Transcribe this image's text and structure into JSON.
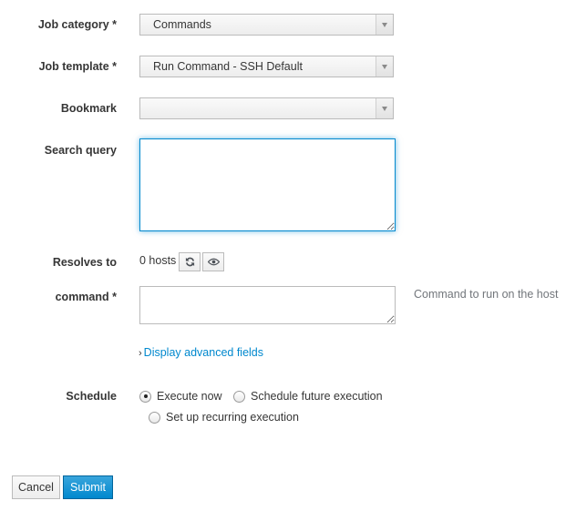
{
  "form": {
    "job_category": {
      "label": "Job category *",
      "value": "Commands"
    },
    "job_template": {
      "label": "Job template *",
      "value": "Run Command - SSH Default"
    },
    "bookmark": {
      "label": "Bookmark",
      "value": ""
    },
    "search_query": {
      "label": "Search query",
      "value": ""
    },
    "resolves_to": {
      "label": "Resolves to",
      "value": "0 hosts",
      "refresh_icon": "refresh-icon",
      "preview_icon": "eye-icon"
    },
    "command": {
      "label": "command *",
      "value": "",
      "help": "Command to run on the host"
    },
    "advanced_link": {
      "chevron": "›",
      "label": "Display advanced fields"
    },
    "schedule": {
      "label": "Schedule",
      "options": [
        {
          "label": "Execute now",
          "checked": true
        },
        {
          "label": "Schedule future execution",
          "checked": false
        },
        {
          "label": "Set up recurring execution",
          "checked": false
        }
      ]
    }
  },
  "actions": {
    "cancel": "Cancel",
    "submit": "Submit"
  },
  "colors": {
    "primary": "#0088ce",
    "focus_border": "#0088ce",
    "text": "#363636",
    "help_text": "#72767b"
  }
}
